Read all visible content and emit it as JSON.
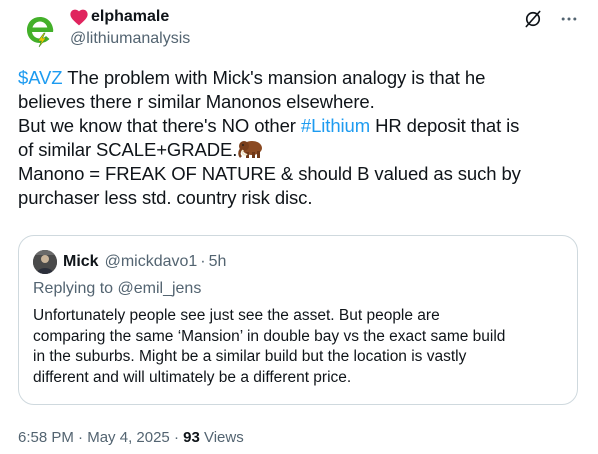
{
  "author": {
    "display_name": "elphamale",
    "handle": "@lithiumanalysis",
    "name_emoji_icon": "red-heart-icon",
    "avatar_icon": "green-e-lightning-logo"
  },
  "actions": {
    "grok_icon": "slashed-circle-icon",
    "more_icon": "more-dots-icon",
    "more_glyph": "···"
  },
  "tweet": {
    "cashtag": "$AVZ",
    "line1_rest": " The problem with Mick's mansion analogy is that he",
    "line2": "believes there r similar Manonos elsewhere.",
    "line3_pre": "But we know that there's NO other ",
    "hashtag": "#Lithium",
    "line3_post": " HR deposit that is",
    "line4": "of similar SCALE+GRADE.",
    "line4_emoji_icon": "mammoth-emoji-icon",
    "line5": "Manono = FREAK OF NATURE & should B valued as such by",
    "line6": "purchaser less std. country risk disc."
  },
  "quote": {
    "name": "Mick",
    "handle": "@mickdavo1",
    "dot": "·",
    "time": "5h",
    "replying_to_label": "Replying to ",
    "replying_to_handle": "@emil_jens",
    "text_lines": [
      "Unfortunately people see just see the asset. But people are",
      "comparing the same ‘Mansion’ in double bay vs the exact same build",
      "in the suburbs. Might be a similar build but the location is vastly",
      "different and will ultimately be a different price."
    ]
  },
  "meta": {
    "time": "6:58 PM",
    "sep1": " · ",
    "date": "May 4, 2025",
    "sep2": " · ",
    "views_count": "93",
    "views_label": " Views"
  },
  "colors": {
    "link": "#1d9bf0",
    "secondary_text": "#536471",
    "primary_text": "#0f1419",
    "border": "#cfd9de",
    "logo_green": "#43b02a",
    "heart_red": "#e0245e"
  }
}
